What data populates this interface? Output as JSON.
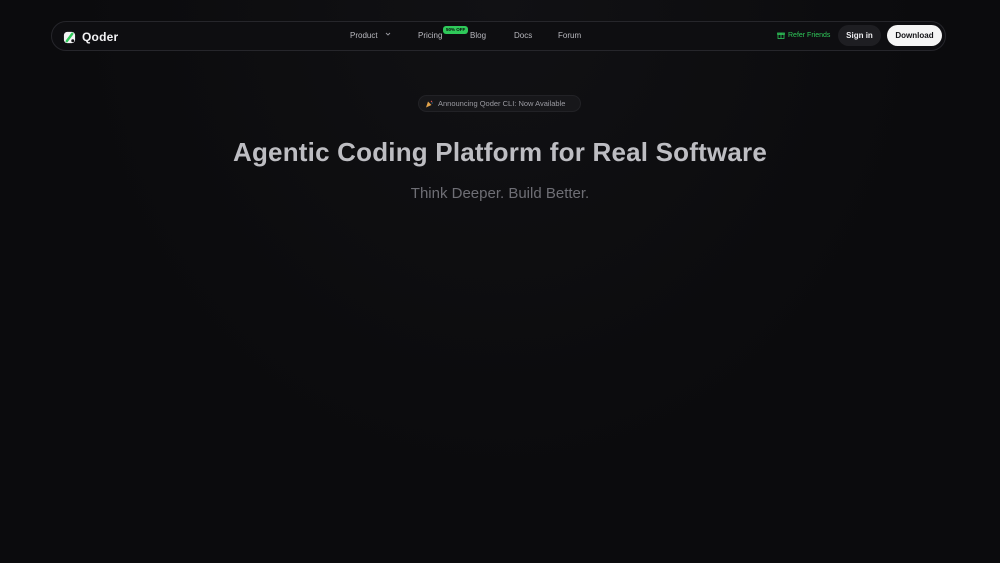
{
  "nav": {
    "logo_text": "Qoder",
    "links": {
      "product": "Product",
      "pricing": "Pricing",
      "pricing_badge": "50% OFF",
      "blog": "Blog",
      "docs": "Docs",
      "forum": "Forum"
    },
    "refer": "Refer Friends",
    "signin": "Sign in",
    "download": "Download"
  },
  "announcement": {
    "text": "Announcing Qoder CLI: Now Available",
    "icon": "party-popper-icon"
  },
  "hero": {
    "title": "Agentic Coding Platform for Real Software",
    "subtitle": "Think Deeper. Build Better."
  },
  "colors": {
    "background": "#0b0b0d",
    "accent_green": "#2fc95a",
    "download_bg": "#f5f5f5"
  }
}
